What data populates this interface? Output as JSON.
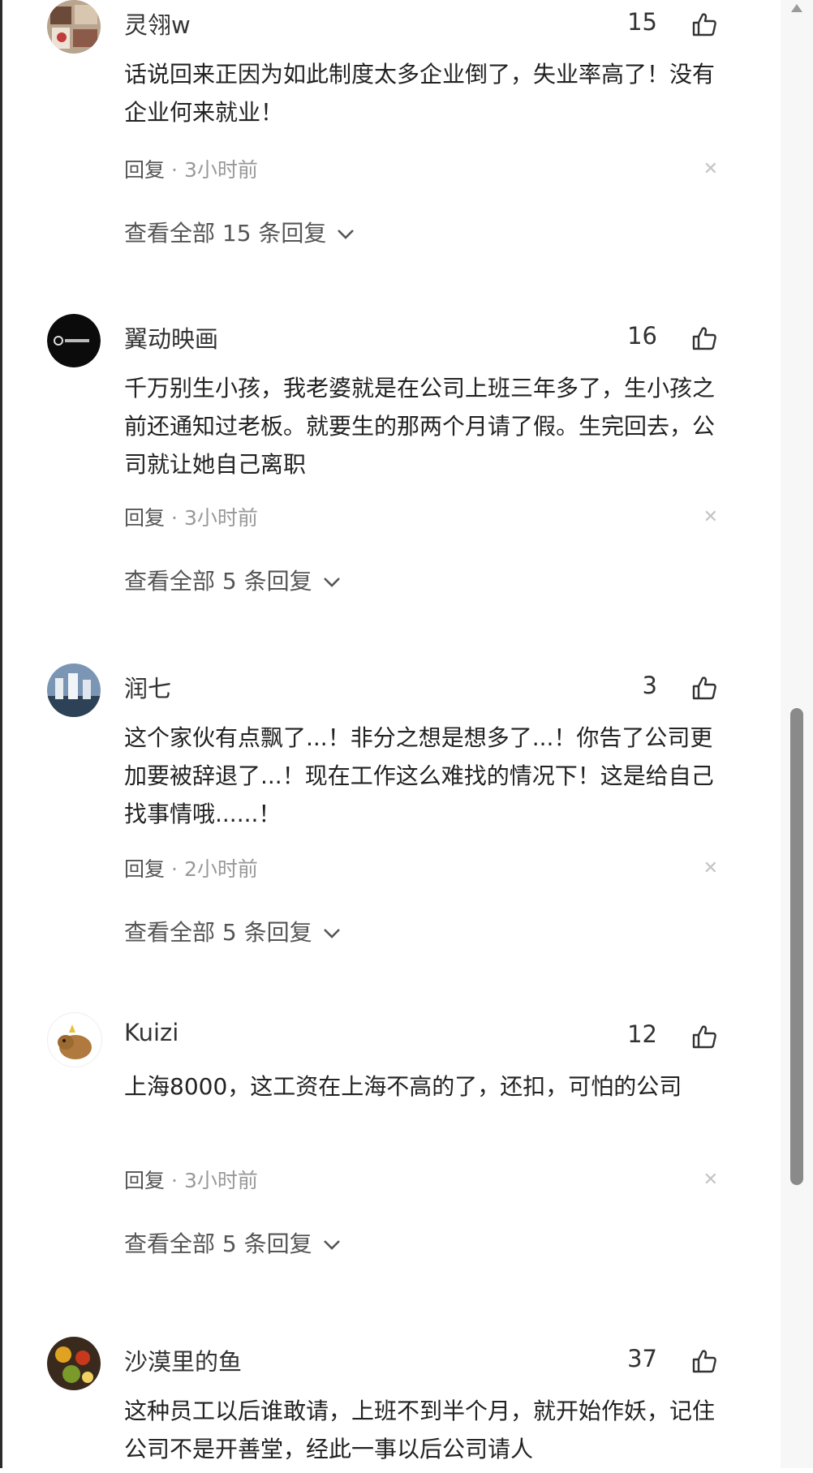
{
  "comments": [
    {
      "username": "灵翎w",
      "likes": "15",
      "content": "话说回来正因为如此制度太多企业倒了，失业率高了！没有企业何来就业！",
      "reply_label": "回复",
      "separator": "·",
      "time": "3小时前",
      "view_replies": "查看全部 15 条回复",
      "avatar_icon": "photo-collage-avatar"
    },
    {
      "username": "翼动映画",
      "likes": "16",
      "content": "千万别生小孩，我老婆就是在公司上班三年多了，生小孩之前还通知过老板。就要生的那两个月请了假。生完回去，公司就让她自己离职",
      "reply_label": "回复",
      "separator": "·",
      "time": "3小时前",
      "view_replies": "查看全部 5 条回复",
      "avatar_icon": "black-logo-avatar"
    },
    {
      "username": "润七",
      "likes": "3",
      "content": "这个家伙有点飘了...！非分之想是想多了...！你告了公司更加要被辞退了...！现在工作这么难找的情况下！这是给自己找事情哦......！",
      "reply_label": "回复",
      "separator": "·",
      "time": "2小时前",
      "view_replies": "查看全部 5 条回复",
      "avatar_icon": "city-photo-avatar"
    },
    {
      "username": "Kuizi",
      "likes": "12",
      "content": "上海8000，这工资在上海不高的了，还扣，可怕的公司",
      "reply_label": "回复",
      "separator": "·",
      "time": "3小时前",
      "view_replies": "查看全部 5 条回复",
      "avatar_icon": "capybara-avatar"
    },
    {
      "username": "沙漠里的鱼",
      "likes": "37",
      "content": "这种员工以后谁敢请，上班不到半个月，就开始作妖，记住公司不是开善堂，经此一事以后公司请人",
      "avatar_icon": "fruit-photo-avatar"
    }
  ],
  "icons": {
    "like": "thumbs-up-icon",
    "close": "close-icon",
    "chevron": "chevron-down-icon"
  },
  "colors": {
    "text": "#222222",
    "muted": "#999999",
    "scrollbar": "#8a8a8a"
  }
}
